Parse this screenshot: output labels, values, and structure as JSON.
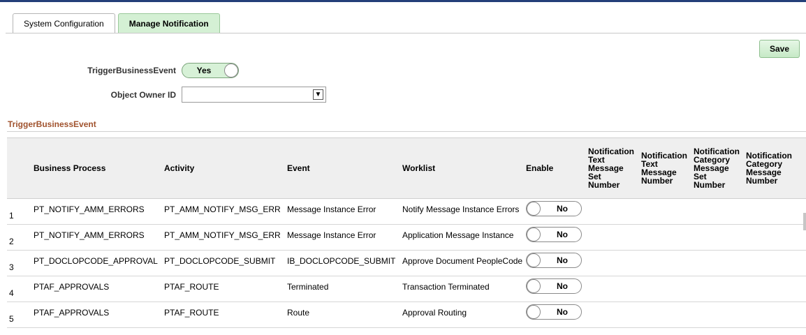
{
  "tabs": [
    {
      "label": "System Configuration"
    },
    {
      "label": "Manage Notification"
    }
  ],
  "toolbar": {
    "save_label": "Save"
  },
  "form": {
    "trigger_label": "TriggerBusinessEvent",
    "trigger_value": "Yes",
    "owner_label": "Object Owner ID",
    "owner_value": ""
  },
  "section": {
    "title": "TriggerBusinessEvent"
  },
  "grid": {
    "headers": {
      "business_process": "Business Process",
      "activity": "Activity",
      "event": "Event",
      "worklist": "Worklist",
      "enable": "Enable",
      "text_set": [
        "Notification",
        "Text",
        "Message",
        "Set",
        "Number"
      ],
      "text_num": [
        "Notification",
        "Text",
        "Message",
        "Number"
      ],
      "cat_set": [
        "Notification",
        "Category",
        "Message",
        "Set",
        "Number"
      ],
      "cat_num": [
        "Notification",
        "Category",
        "Message",
        "Number"
      ]
    },
    "rows": [
      {
        "n": "1",
        "bp": "PT_NOTIFY_AMM_ERRORS",
        "act": "PT_AMM_NOTIFY_MSG_ERR",
        "ev": "Message Instance Error",
        "wl": "Notify Message Instance Errors",
        "en": "No"
      },
      {
        "n": "2",
        "bp": "PT_NOTIFY_AMM_ERRORS",
        "act": "PT_AMM_NOTIFY_MSG_ERR",
        "ev": "Message Instance Error",
        "wl": "Application Message Instance",
        "en": "No"
      },
      {
        "n": "3",
        "bp": "PT_DOCLOPCODE_APPROVAL",
        "act": "PT_DOCLOPCODE_SUBMIT",
        "ev": "IB_DOCLOPCODE_SUBMIT",
        "wl": "Approve Document PeopleCode",
        "en": "No"
      },
      {
        "n": "4",
        "bp": "PTAF_APPROVALS",
        "act": "PTAF_ROUTE",
        "ev": "Terminated",
        "wl": "Transaction Terminated",
        "en": "No"
      },
      {
        "n": "5",
        "bp": "PTAF_APPROVALS",
        "act": "PTAF_ROUTE",
        "ev": "Route",
        "wl": "Approval Routing",
        "en": "No"
      }
    ]
  },
  "colors": {
    "accent_green": "#d4f0d4",
    "section_title": "#a0522d",
    "top_bar": "#243f79"
  },
  "icons": {
    "dropdown": "chevron-down-icon"
  }
}
